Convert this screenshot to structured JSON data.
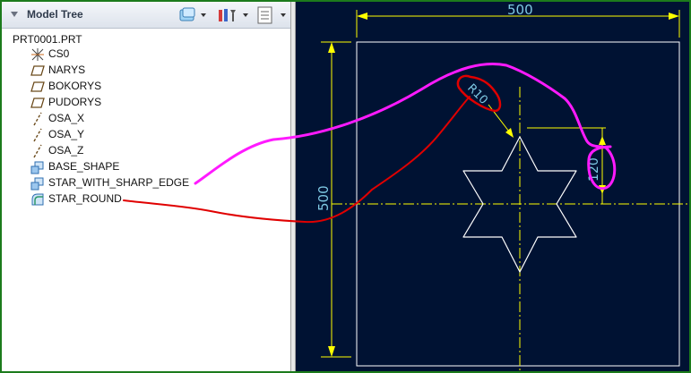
{
  "tree": {
    "title": "Model Tree",
    "root": "PRT0001.PRT",
    "items": [
      {
        "label": "CS0",
        "icon": "coordinate-system-icon"
      },
      {
        "label": "NARYS",
        "icon": "datum-plane-icon"
      },
      {
        "label": "BOKORYS",
        "icon": "datum-plane-icon"
      },
      {
        "label": "PUDORYS",
        "icon": "datum-plane-icon"
      },
      {
        "label": "OSA_X",
        "icon": "datum-axis-icon"
      },
      {
        "label": "OSA_Y",
        "icon": "datum-axis-icon"
      },
      {
        "label": "OSA_Z",
        "icon": "datum-axis-icon"
      },
      {
        "label": "BASE_SHAPE",
        "icon": "extrude-icon"
      },
      {
        "label": "STAR_WITH_SHARP_EDGE",
        "icon": "extrude-icon"
      },
      {
        "label": "STAR_ROUND",
        "icon": "round-icon"
      }
    ]
  },
  "toolbar": {
    "show_icon": "show-icon",
    "settings_icon": "tree-settings-icon",
    "columns_icon": "tree-columns-icon"
  },
  "sketch": {
    "width_dim": "500",
    "height_dim": "500",
    "radius_dim": "R10",
    "offset_dim": "120"
  },
  "colors": {
    "viewport_bg": "#001233",
    "dimension": "#ffff00",
    "dimension_text": "#7ec8e3",
    "geometry": "#ffffff",
    "annotation_magenta": "#ff1aff",
    "annotation_red": "#e00000",
    "frame_border": "#1c7b1c"
  }
}
